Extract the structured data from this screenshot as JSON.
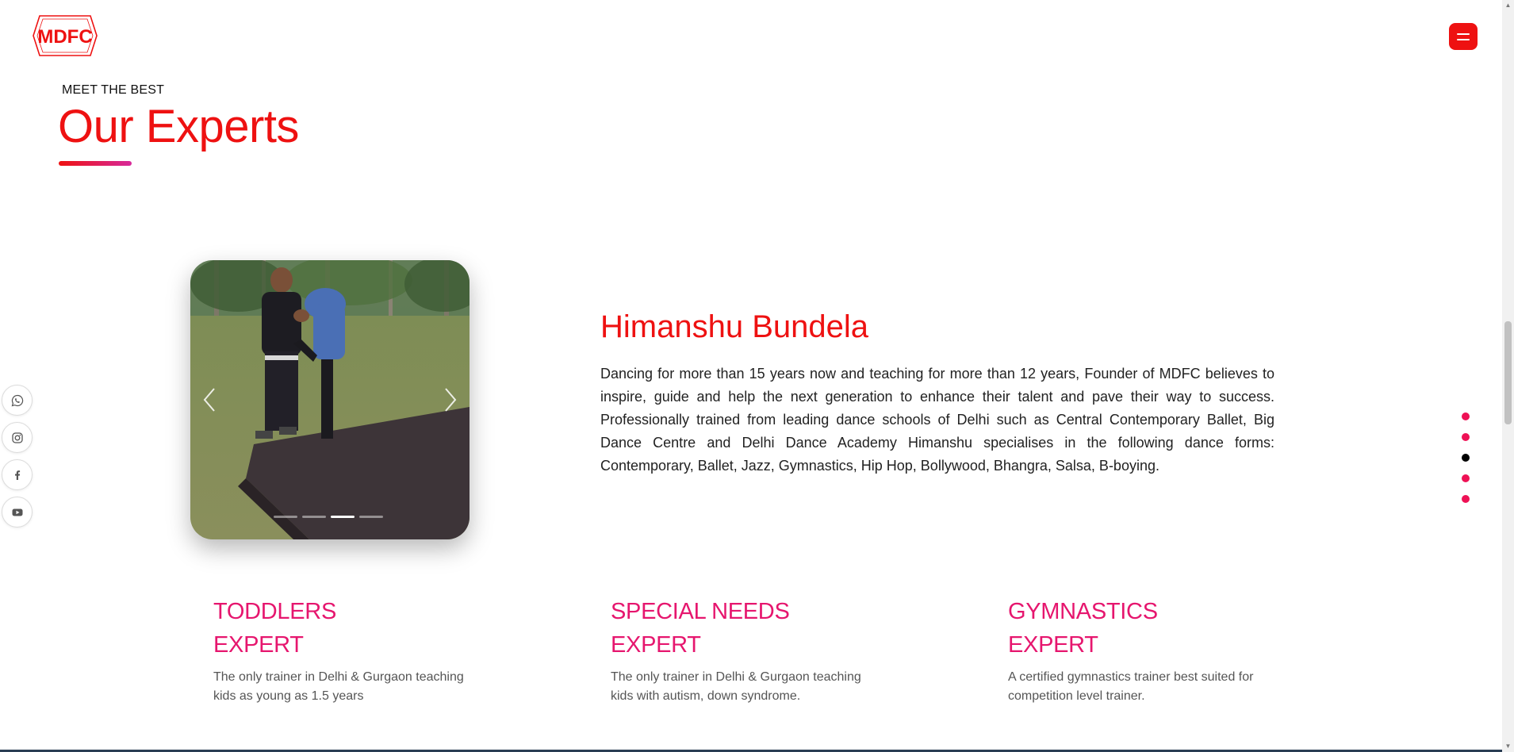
{
  "header": {
    "logo_text": "MDFC",
    "menu_icon": "hamburger-icon",
    "brand_color": "#ee1111"
  },
  "section": {
    "eyebrow": "MEET THE BEST",
    "title": "Our Experts"
  },
  "social": [
    {
      "name": "whatsapp",
      "icon": "whatsapp-icon"
    },
    {
      "name": "instagram",
      "icon": "instagram-icon"
    },
    {
      "name": "facebook",
      "icon": "facebook-icon"
    },
    {
      "name": "youtube",
      "icon": "youtube-icon"
    }
  ],
  "slider": {
    "slide_count": 4,
    "active_index": 3
  },
  "expert": {
    "name": "Himanshu Bundela",
    "bio": "Dancing for more than 15 years now and teaching for more than 12 years, Founder of MDFC believes to inspire, guide and help the next generation to enhance their talent and pave their way to success. Professionally trained from leading dance schools of Delhi such as Central Contemporary Ballet, Big Dance Centre and Delhi Dance Academy Himanshu specialises in the following dance forms: Contemporary, Ballet, Jazz, Gymnastics, Hip Hop, Bollywood, Bhangra, Salsa, B-boying."
  },
  "pager": {
    "count": 5,
    "active_index": 3
  },
  "cards": [
    {
      "title_line1": "TODDLERS",
      "title_line2": "EXPERT",
      "text": "The only trainer in Delhi & Gurgaon teaching kids as young as 1.5 years"
    },
    {
      "title_line1": "SPECIAL NEEDS",
      "title_line2": "EXPERT",
      "text": "The only trainer in Delhi & Gurgaon teaching kids with autism, down syndrome."
    },
    {
      "title_line1": "GYMNASTICS",
      "title_line2": "EXPERT",
      "text": "A certified gymnastics trainer best suited for competition level trainer."
    }
  ],
  "colors": {
    "accent_red": "#ee1111",
    "accent_pink": "#e6166e",
    "pager_dot": "#ee1155",
    "pager_active": "#000000"
  }
}
